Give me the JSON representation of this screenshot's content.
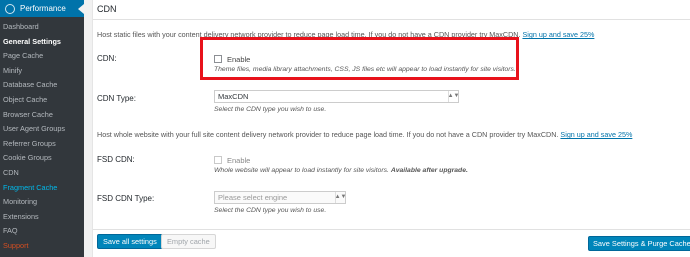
{
  "sidebar": {
    "header_label": "Performance",
    "items": [
      {
        "label": "Dashboard"
      },
      {
        "label": "General Settings"
      },
      {
        "label": "Page Cache"
      },
      {
        "label": "Minify"
      },
      {
        "label": "Database Cache"
      },
      {
        "label": "Object Cache"
      },
      {
        "label": "Browser Cache"
      },
      {
        "label": "User Agent Groups"
      },
      {
        "label": "Referrer Groups"
      },
      {
        "label": "Cookie Groups"
      },
      {
        "label": "CDN"
      },
      {
        "label": "Fragment Cache"
      },
      {
        "label": "Monitoring"
      },
      {
        "label": "Extensions"
      },
      {
        "label": "FAQ"
      },
      {
        "label": "Support"
      }
    ]
  },
  "main": {
    "section_title": "CDN",
    "cdn_desc": {
      "text": "Host static files with your content delivery network provider to reduce page load time. If you do not have a CDN provider try MaxCDN.",
      "link": "Sign up and save 25%"
    },
    "cdn": {
      "label": "CDN:",
      "checkbox_label": "Enable",
      "hint": "Theme files, media library attachments, CSS, JS files etc will appear to load instantly for site visitors."
    },
    "cdn_type": {
      "label": "CDN Type:",
      "value": "MaxCDN",
      "hint": "Select the CDN type you wish to use."
    },
    "fsd_desc": {
      "text": "Host whole website with your full site content delivery network provider to reduce page load time. If you do not have a CDN provider try MaxCDN.",
      "link": "Sign up and save 25%"
    },
    "fsd_cdn": {
      "label": "FSD CDN:",
      "checkbox_label": "Enable",
      "hint": "Whole website will appear to load instantly for site visitors.",
      "hint_bold": "Available after upgrade."
    },
    "fsd_cdn_type": {
      "label": "FSD CDN Type:",
      "placeholder": "Please select engine",
      "hint": "Select the CDN type you wish to use."
    },
    "buttons": {
      "save_all": "Save all settings",
      "empty_cache": "Empty cache",
      "save_purge": "Save Settings & Purge Caches"
    }
  },
  "colors": {
    "accent": "#0073aa",
    "sidebar_bg": "#32373c",
    "highlight_box": "#e8121b",
    "primary_button": "#0085ba"
  }
}
